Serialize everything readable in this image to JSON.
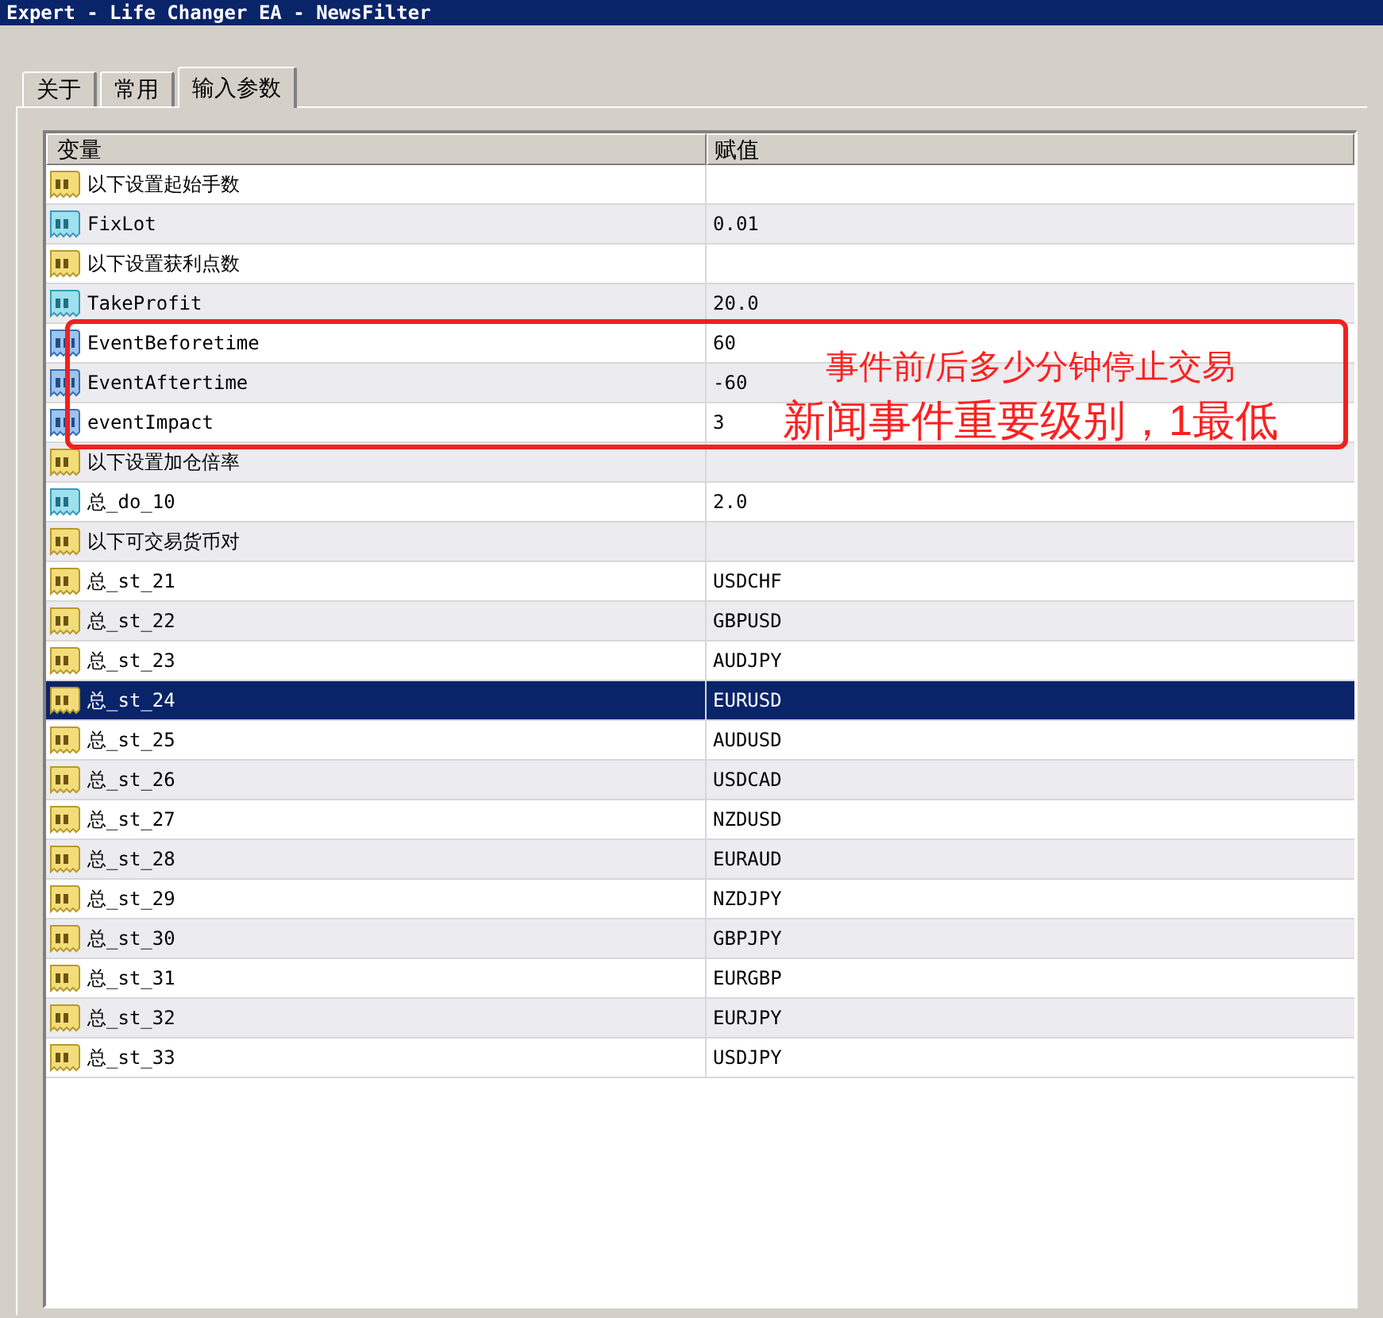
{
  "window": {
    "title": "Expert - Life Changer EA - NewsFilter"
  },
  "tabs": [
    {
      "label": "关于",
      "selected": false
    },
    {
      "label": "常用",
      "selected": false
    },
    {
      "label": "输入参数",
      "selected": true
    }
  ],
  "table": {
    "columns": [
      "变量",
      "赋值"
    ],
    "rows": [
      {
        "kind": "string",
        "name": "以下设置起始手数",
        "selected": false
      },
      {
        "kind": "double",
        "name": "FixLot",
        "value": "0.01",
        "selected": false
      },
      {
        "kind": "string",
        "name": "以下设置获利点数",
        "selected": false
      },
      {
        "kind": "double",
        "name": "TakeProfit",
        "value": "20.0",
        "selected": false
      },
      {
        "kind": "int",
        "name": "EventBeforetime",
        "value": "60",
        "selected": false
      },
      {
        "kind": "int",
        "name": "EventAftertime",
        "value": "-60",
        "selected": false
      },
      {
        "kind": "int",
        "name": "eventImpact",
        "value": "3",
        "selected": false
      },
      {
        "kind": "string",
        "name": "以下设置加仓倍率",
        "selected": false
      },
      {
        "kind": "double",
        "name": "总_do_10",
        "value": "2.0",
        "selected": false
      },
      {
        "kind": "string",
        "name": "以下可交易货币对",
        "selected": false
      },
      {
        "kind": "string",
        "name": "总_st_21",
        "value": "USDCHF",
        "selected": false
      },
      {
        "kind": "string",
        "name": "总_st_22",
        "value": "GBPUSD",
        "selected": false
      },
      {
        "kind": "string",
        "name": "总_st_23",
        "value": "AUDJPY",
        "selected": false
      },
      {
        "kind": "string",
        "name": "总_st_24",
        "value": "EURUSD",
        "selected": true
      },
      {
        "kind": "string",
        "name": "总_st_25",
        "value": "AUDUSD",
        "selected": false
      },
      {
        "kind": "string",
        "name": "总_st_26",
        "value": "USDCAD",
        "selected": false
      },
      {
        "kind": "string",
        "name": "总_st_27",
        "value": "NZDUSD",
        "selected": false
      },
      {
        "kind": "string",
        "name": "总_st_28",
        "value": "EURAUD",
        "selected": false
      },
      {
        "kind": "string",
        "name": "总_st_29",
        "value": "NZDJPY",
        "selected": false
      },
      {
        "kind": "string",
        "name": "总_st_30",
        "value": "GBPJPY",
        "selected": false
      },
      {
        "kind": "string",
        "name": "总_st_31",
        "value": "EURGBP",
        "selected": false
      },
      {
        "kind": "string",
        "name": "总_st_32",
        "value": "EURJPY",
        "selected": false
      },
      {
        "kind": "string",
        "name": "总_st_33",
        "value": "USDJPY",
        "selected": false
      }
    ]
  },
  "annotation": {
    "lines": [
      "事件前/后多少分钟停止交易",
      "新闻事件重要级别，1最低"
    ]
  }
}
